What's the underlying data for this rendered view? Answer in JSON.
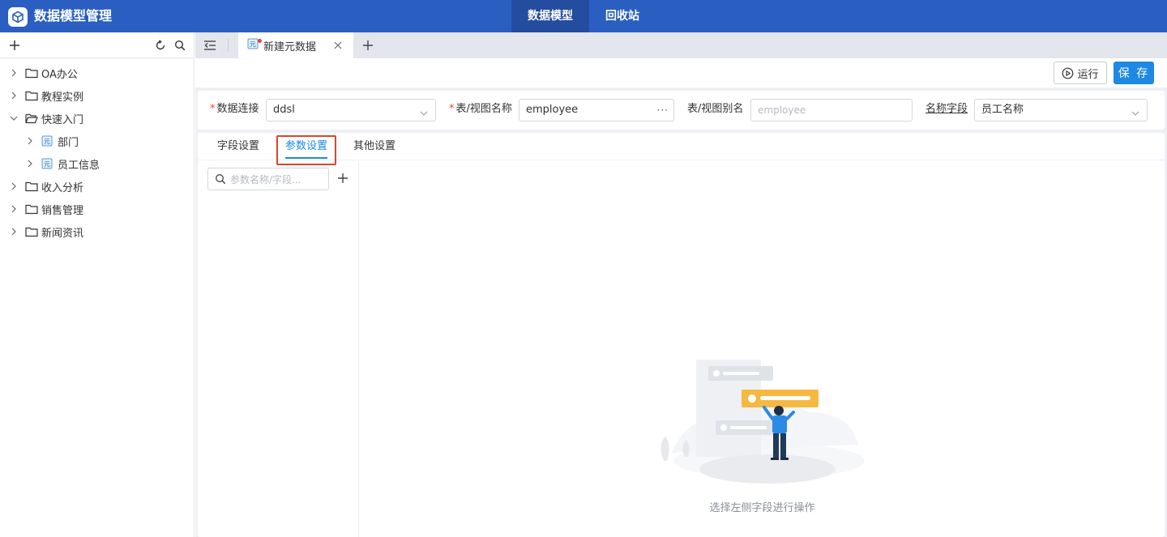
{
  "header": {
    "app_title": "数据模型管理",
    "nav": [
      {
        "label": "数据模型",
        "active": true
      },
      {
        "label": "回收站",
        "active": false
      }
    ]
  },
  "sidebar": {
    "tree": [
      {
        "label": "OA办公",
        "type": "folder",
        "expanded": false,
        "level": 0
      },
      {
        "label": "教程实例",
        "type": "folder",
        "expanded": false,
        "level": 0
      },
      {
        "label": "快速入门",
        "type": "folder",
        "expanded": true,
        "level": 0
      },
      {
        "label": "部门",
        "type": "model",
        "expanded": false,
        "level": 1
      },
      {
        "label": "员工信息",
        "type": "model",
        "expanded": false,
        "level": 1
      },
      {
        "label": "收入分析",
        "type": "folder",
        "expanded": false,
        "level": 0
      },
      {
        "label": "销售管理",
        "type": "folder",
        "expanded": false,
        "level": 0
      },
      {
        "label": "新闻资讯",
        "type": "folder",
        "expanded": false,
        "level": 0
      }
    ]
  },
  "tabs": {
    "open": [
      {
        "label": "新建元数据",
        "modified": true
      }
    ]
  },
  "toolbar": {
    "run_label": "运行",
    "save_label": "保 存"
  },
  "form": {
    "connection_label": "数据连接",
    "connection_value": "ddsl",
    "table_label": "表/视图名称",
    "table_value": "employee",
    "alias_label": "表/视图别名",
    "alias_placeholder": "employee",
    "name_field_label": "名称字段",
    "name_field_value": "员工名称"
  },
  "subtabs": [
    {
      "label": "字段设置",
      "active": false
    },
    {
      "label": "参数设置",
      "active": true
    },
    {
      "label": "其他设置",
      "active": false
    }
  ],
  "params": {
    "search_placeholder": "参数名称/字段..."
  },
  "empty": {
    "message": "选择左侧字段进行操作"
  },
  "colors": {
    "header_bg": "#2a5fc1",
    "accent": "#1e88e5",
    "highlight": "#d9472b"
  }
}
